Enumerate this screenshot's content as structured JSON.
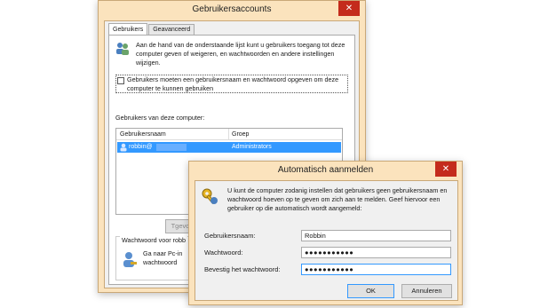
{
  "main_window": {
    "title": "Gebruikersaccounts",
    "close_glyph": "✕",
    "tabs": [
      {
        "label": "Gebruikers",
        "active": true
      },
      {
        "label": "Geavanceerd",
        "active": false
      }
    ],
    "intro_text": "Aan de hand van de onderstaande lijst kunt u gebruikers toegang tot deze computer geven of weigeren, en wachtwoorden en andere instellingen wijzigen.",
    "require_password_label": "Gebruikers moeten een gebruikersnaam en wachtwoord opgeven om deze computer te kunnen gebruiken",
    "users_section_label": "Gebruikers van deze computer:",
    "table": {
      "columns": [
        "Gebruikersnaam",
        "Groep"
      ],
      "rows": [
        {
          "name": "robbin@",
          "group": "Administrators"
        }
      ]
    },
    "add_button_label": "Tgevo",
    "password_group_label": "Wachtwoord voor robb",
    "password_group_text_1": "Ga naar Pc-in",
    "password_group_text_2": "wachtwoord"
  },
  "dialog": {
    "title": "Automatisch aanmelden",
    "close_glyph": "✕",
    "description": "U kunt de computer zodanig instellen dat gebruikers geen gebruikersnaam en wachtwoord hoeven op te geven om zich aan te melden. Geef hiervoor een gebruiker op die automatisch wordt aangemeld:",
    "username_label": "Gebruikersnaam:",
    "username_value": "Robbin",
    "password_label": "Wachtwoord:",
    "password_value": "●●●●●●●●●●●",
    "confirm_label": "Bevestig het wachtwoord:",
    "confirm_value": "●●●●●●●●●●●",
    "ok_label": "OK",
    "cancel_label": "Annuleren"
  },
  "colors": {
    "frame": "#fbe3bd",
    "close": "#c42b1c",
    "selection": "#3399ff"
  }
}
